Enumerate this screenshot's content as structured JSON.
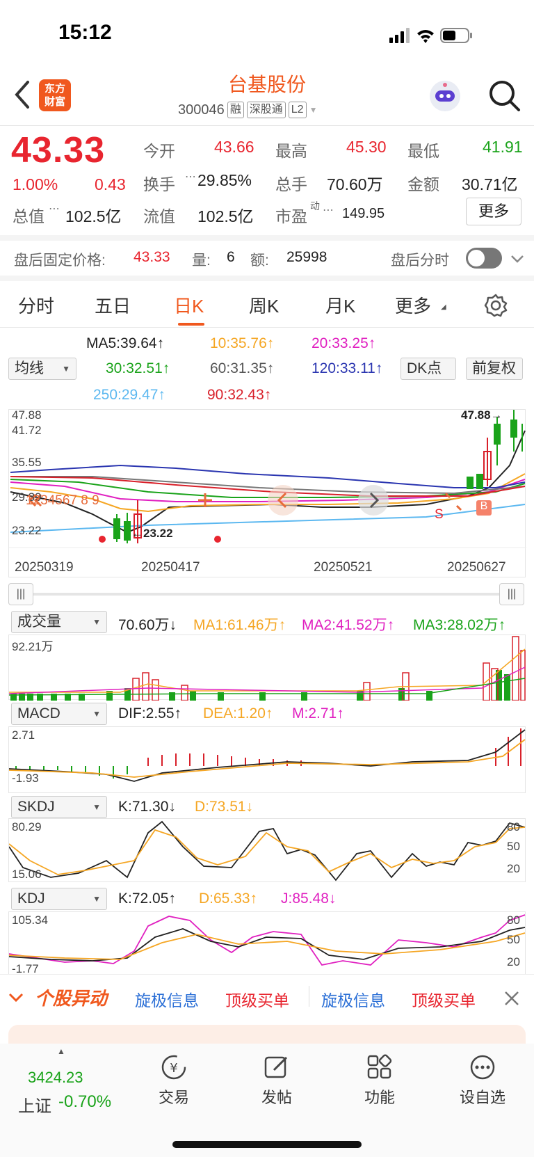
{
  "status": {
    "time": "15:12"
  },
  "header": {
    "logo_line1": "东方",
    "logo_line2": "财富",
    "name": "台基股份",
    "code": "300046",
    "tags": [
      "融",
      "深股通",
      "L2"
    ]
  },
  "quote": {
    "price": "43.33",
    "change_pct": "1.00%",
    "change": "0.43",
    "open_label": "今开",
    "open": "43.66",
    "high_label": "最高",
    "high": "45.30",
    "low_label": "最低",
    "low": "41.91",
    "turnover_label": "换手",
    "turnover": "29.85%",
    "volume_label": "总手",
    "volume": "70.60万",
    "amount_label": "金额",
    "amount": "30.71亿",
    "mcap_label": "总值",
    "mcap": "102.5亿",
    "float_label": "流值",
    "float": "102.5亿",
    "pe_label": "市盈",
    "pe_sup": "动",
    "pe": "149.95",
    "more": "更多"
  },
  "afterhours": {
    "label": "盘后固定价格:",
    "price": "43.33",
    "vol_label": "量:",
    "vol": "6",
    "amt_label": "额:",
    "amt": "25998",
    "timeshare": "盘后分时"
  },
  "tabs": [
    "分时",
    "五日",
    "日K",
    "周K",
    "月K",
    "更多"
  ],
  "ma": {
    "selector": "均线",
    "ma5": "MA5:39.64↑",
    "ma10": "10:35.76↑",
    "ma20": "20:33.25↑",
    "ma30": "30:32.51↑",
    "ma60": "60:31.35↑",
    "ma120": "120:33.11↑",
    "ma250": "250:29.47↑",
    "ma90": "90:32.43↑",
    "dk": "DK点",
    "fq": "前复权"
  },
  "kchart": {
    "y_labels": [
      "47.88",
      "41.72",
      "35.55",
      "29.39",
      "23.22"
    ],
    "high_mark": "47.88→",
    "low_mark": "←23.22",
    "dates": [
      "20250319",
      "20250417",
      "20250521",
      "20250627"
    ],
    "nums_left": "1234567 8 9",
    "signal_b": "B",
    "signal_s": "S"
  },
  "volume": {
    "selector": "成交量",
    "value": "70.60万↓",
    "ma1": "MA1:61.46万↑",
    "ma2": "MA2:41.52万↑",
    "ma3": "MA3:28.02万↑",
    "ymax": "92.21万"
  },
  "macd": {
    "selector": "MACD",
    "dif": "DIF:2.55↑",
    "dea": "DEA:1.20↑",
    "m": "M:2.71↑",
    "ymax": "2.71",
    "ymin": "-1.93"
  },
  "skdj": {
    "selector": "SKDJ",
    "k": "K:71.30↓",
    "d": "D:73.51↓",
    "ymax": "80.29",
    "ymin": "15.06",
    "r1": "80",
    "r2": "50",
    "r3": "20"
  },
  "kdj": {
    "selector": "KDJ",
    "k": "K:72.05↑",
    "d": "D:65.33↑",
    "j": "J:85.48↓",
    "ymax": "105.34",
    "ymin": "-1.77",
    "r1": "80",
    "r2": "50",
    "r3": "20"
  },
  "banner": {
    "title": "个股异动",
    "items": [
      "旋极信息",
      "顶级买单",
      "旋极信息",
      "顶级买单"
    ]
  },
  "tabbar": {
    "index_value": "3424.23",
    "index_name": "上证",
    "index_change": "-0.70%",
    "items": [
      "交易",
      "发帖",
      "功能",
      "设自选"
    ]
  },
  "chart_data": {
    "type": "candlestick",
    "ylim": [
      23.22,
      47.88
    ],
    "x_ticks": [
      "20250319",
      "20250417",
      "20250521",
      "20250627"
    ],
    "high": 47.88,
    "low": 23.22,
    "last_close": 43.33
  }
}
